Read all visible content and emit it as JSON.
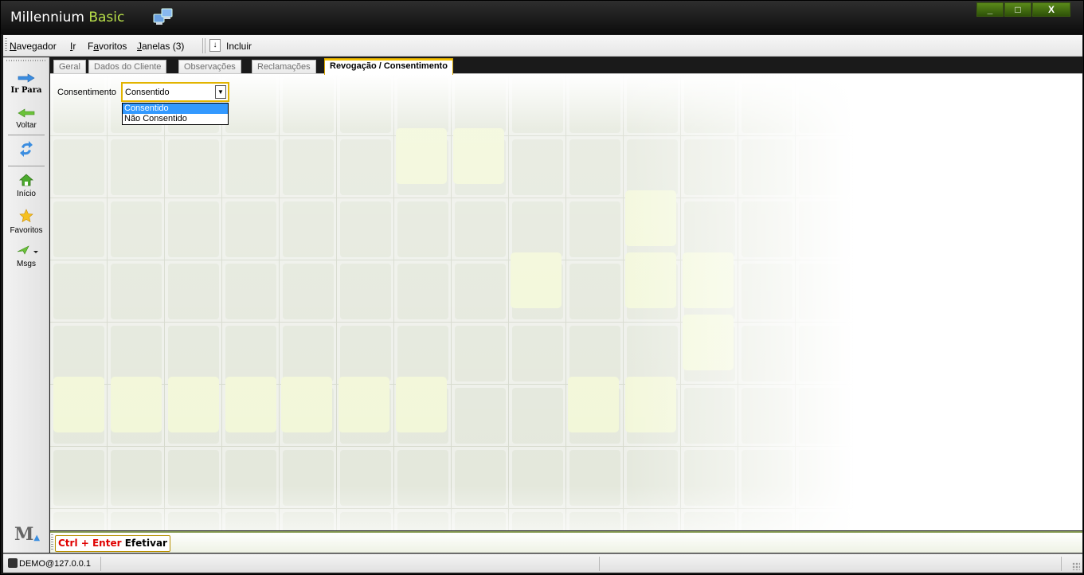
{
  "app": {
    "title_main": "Millennium",
    "title_accent": "Basic",
    "window_buttons": {
      "minimize": "_",
      "maximize": "□",
      "close": "X"
    }
  },
  "menubar": {
    "items": [
      {
        "label": "Navegador",
        "accel": "N",
        "rest": "avegador"
      },
      {
        "label": "Ir",
        "accel": "I",
        "rest": "r"
      },
      {
        "label": "Favoritos",
        "accel": "",
        "pre": "F",
        "accel2": "a",
        "rest": "voritos"
      },
      {
        "label": "Janelas (3)",
        "accel": "J",
        "rest": "anelas (3)"
      }
    ],
    "incluir_arrow": "↓",
    "incluir_label": "Incluir"
  },
  "sidebar": {
    "ir_para": "Ir Para",
    "voltar": "Voltar",
    "inicio": "Início",
    "favoritos": "Favoritos",
    "msgs": "Msgs",
    "logo": "M"
  },
  "tabs": [
    {
      "label": "Geral"
    },
    {
      "label": "Dados do Cliente"
    },
    {
      "label": "Observações"
    },
    {
      "label": "Reclamações"
    },
    {
      "label": "Revogação / Consentimento",
      "active": true
    }
  ],
  "form": {
    "label": "Consentimento",
    "value": "Consentido",
    "options": [
      "Consentido",
      "Não Consentido"
    ],
    "selected_index": 0
  },
  "actionbar": {
    "shortcut": "Ctrl + Enter",
    "label": "Efetivar"
  },
  "statusbar": {
    "user": "DEMO@127.0.0.1"
  },
  "colors": {
    "accent_green": "#b9e04a",
    "focus_yellow": "#e2b400",
    "selection_blue": "#3399ff",
    "shortcut_red": "#e00000"
  }
}
